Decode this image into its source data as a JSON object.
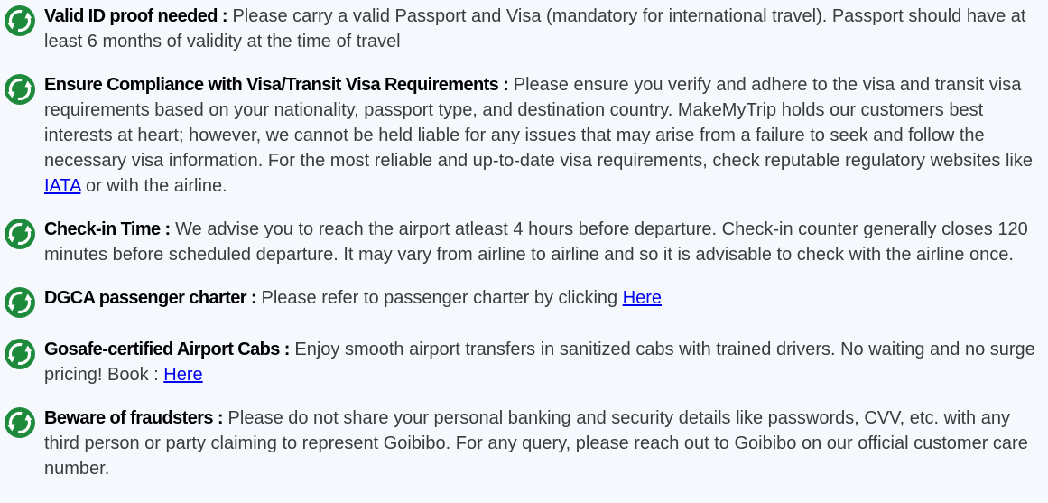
{
  "icon": "recycle-arrows-icon",
  "colors": {
    "icon_green": "#1e8a3b",
    "link": "#0000ee",
    "body_text": "#3b3b3b",
    "background": "#f5f9fd"
  },
  "notes": [
    {
      "title": "Valid ID proof needed :",
      "body": " Please carry a valid Passport and Visa (mandatory for international travel). Passport should have at least 6 months of validity at the time of travel"
    },
    {
      "title": "Ensure Compliance with Visa/Transit Visa Requirements :",
      "body": " Please ensure you verify and adhere to the visa and transit visa requirements based on your nationality, passport type, and destination country. MakeMyTrip holds our customers best interests at heart; however, we cannot be held liable for any issues that may arise from a failure to seek and follow the necessary visa information. For the most reliable and up-to-date visa requirements, check reputable regulatory websites like ",
      "link": "IATA",
      "after": " or with the airline."
    },
    {
      "title": "Check-in Time :",
      "body": " We advise you to reach the airport atleast 4 hours before departure. Check-in counter generally closes 120 minutes before scheduled departure. It may vary from airline to airline and so it is advisable to check with the airline once."
    },
    {
      "title": "DGCA passenger charter :",
      "body": " Please refer to passenger charter by clicking ",
      "link": "Here"
    },
    {
      "title": "Gosafe-certified Airport Cabs :",
      "body": " Enjoy smooth airport transfers in sanitized cabs with trained drivers. No waiting and no surge pricing! Book : ",
      "link": "Here"
    },
    {
      "title": "Beware of fraudsters :",
      "body": " Please do not share your personal banking and security details like passwords, CVV, etc. with any third person or party claiming to represent Goibibo. For any query, please reach out to Goibibo on our official customer care number."
    }
  ]
}
